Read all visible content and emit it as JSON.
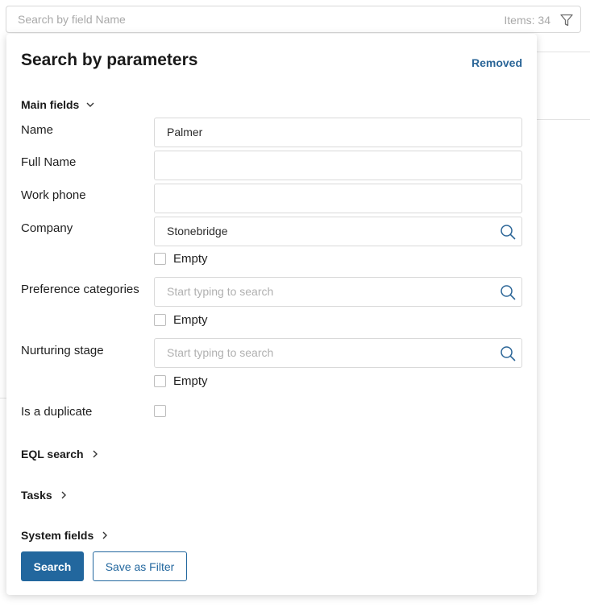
{
  "search": {
    "placeholder": "Search by field Name",
    "items_count": "Items: 34"
  },
  "panel": {
    "title": "Search by parameters",
    "removed_label": "Removed",
    "main_fields_label": "Main fields",
    "fields": {
      "name": {
        "label": "Name",
        "value": "Palmer"
      },
      "full_name": {
        "label": "Full Name",
        "value": ""
      },
      "work_phone": {
        "label": "Work phone",
        "value": ""
      },
      "company": {
        "label": "Company",
        "value": "Stonebridge",
        "empty_label": "Empty"
      },
      "preference_categories": {
        "label": "Preference categories",
        "placeholder": "Start typing to search",
        "empty_label": "Empty"
      },
      "nurturing_stage": {
        "label": "Nurturing stage",
        "placeholder": "Start typing to search",
        "empty_label": "Empty"
      },
      "is_duplicate": {
        "label": "Is a duplicate"
      }
    },
    "sections": {
      "eql": "EQL search",
      "tasks": "Tasks",
      "system_fields": "System fields"
    },
    "buttons": {
      "search": "Search",
      "save_filter": "Save as Filter"
    }
  },
  "colors": {
    "accent": "#22679e",
    "link": "#2a6597",
    "border": "#d9d9d9"
  },
  "icons": [
    "filter-icon",
    "chevron-down-icon",
    "chevron-right-icon",
    "search-icon"
  ]
}
